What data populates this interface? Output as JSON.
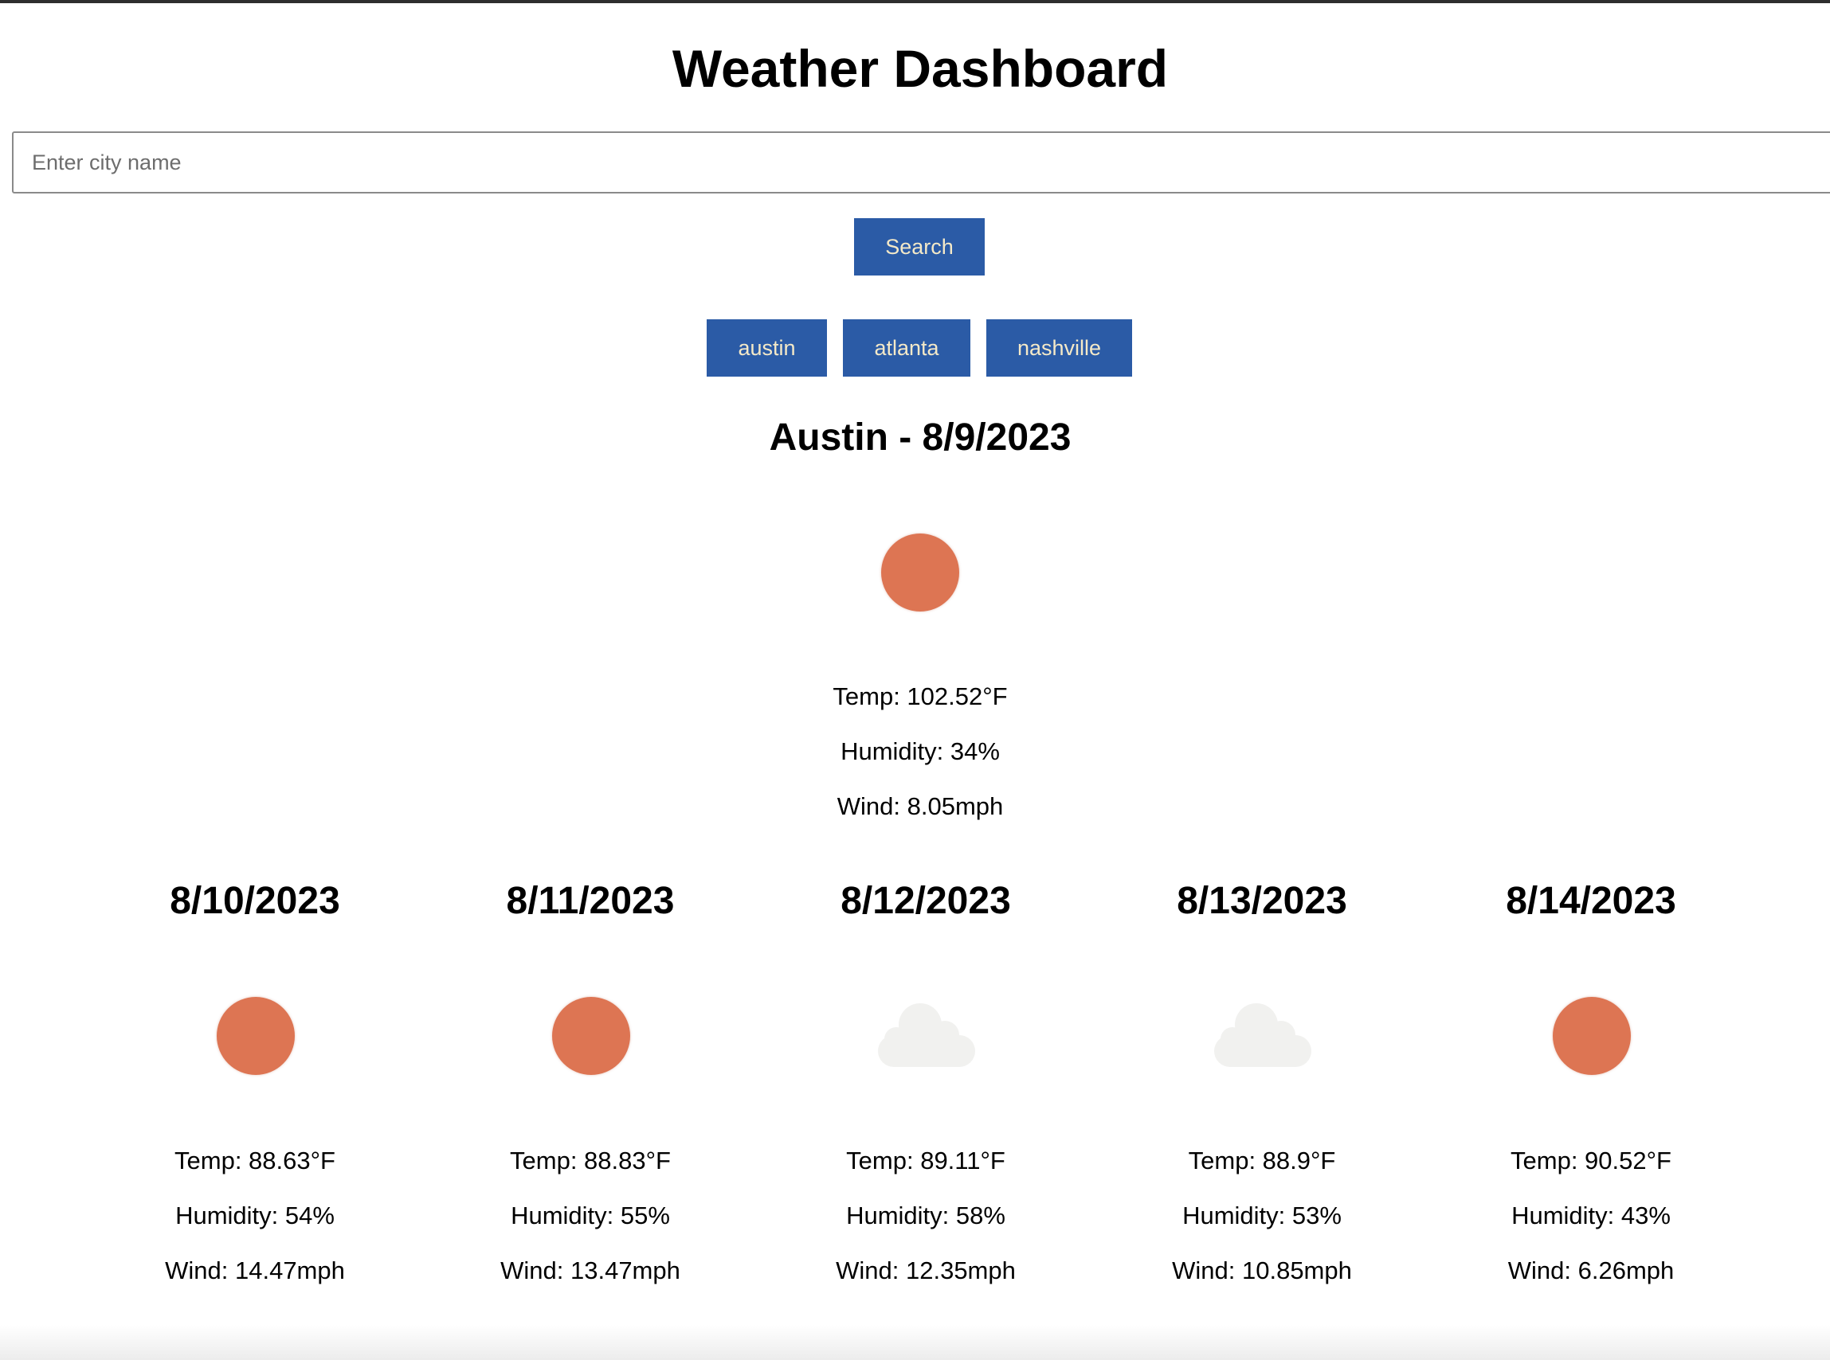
{
  "header": {
    "title": "Weather Dashboard"
  },
  "search": {
    "placeholder": "Enter city name",
    "value": "",
    "button_label": "Search"
  },
  "history": [
    {
      "label": "austin"
    },
    {
      "label": "atlanta"
    },
    {
      "label": "nashville"
    }
  ],
  "current": {
    "title": "Austin - 8/9/2023",
    "icon": "sun-icon",
    "temp": "Temp: 102.52°F",
    "humidity": "Humidity: 34%",
    "wind": "Wind: 8.05mph"
  },
  "forecast": [
    {
      "date": "8/10/2023",
      "icon": "sun-icon",
      "temp": "Temp: 88.63°F",
      "humidity": "Humidity: 54%",
      "wind": "Wind: 14.47mph"
    },
    {
      "date": "8/11/2023",
      "icon": "sun-icon",
      "temp": "Temp: 88.83°F",
      "humidity": "Humidity: 55%",
      "wind": "Wind: 13.47mph"
    },
    {
      "date": "8/12/2023",
      "icon": "cloud-icon",
      "temp": "Temp: 89.11°F",
      "humidity": "Humidity: 58%",
      "wind": "Wind: 12.35mph"
    },
    {
      "date": "8/13/2023",
      "icon": "cloud-icon",
      "temp": "Temp: 88.9°F",
      "humidity": "Humidity: 53%",
      "wind": "Wind: 10.85mph"
    },
    {
      "date": "8/14/2023",
      "icon": "sun-icon",
      "temp": "Temp: 90.52°F",
      "humidity": "Humidity: 43%",
      "wind": "Wind: 6.26mph"
    }
  ],
  "colors": {
    "button_bg": "#2b5ba6",
    "button_text": "#f4e9c8",
    "sun": "#dd7553",
    "cloud": "#f1f1ef"
  }
}
